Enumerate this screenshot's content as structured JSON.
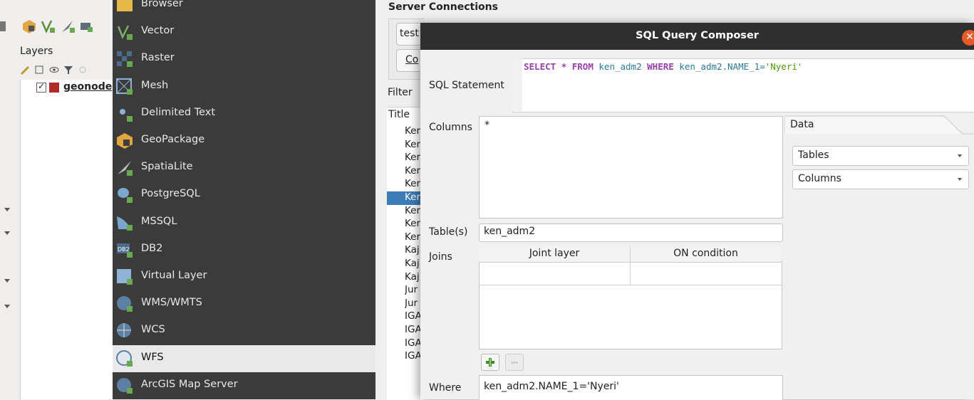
{
  "main_window": {
    "layers_panel": {
      "title": "Layers",
      "layer_item": {
        "label": "geonode",
        "checked": true,
        "color": "#b22b2b"
      }
    }
  },
  "data_source_manager": {
    "items": [
      {
        "label": "Browser",
        "icon": "folder-icon"
      },
      {
        "label": "Vector",
        "icon": "vector-icon"
      },
      {
        "label": "Raster",
        "icon": "raster-icon"
      },
      {
        "label": "Mesh",
        "icon": "mesh-icon"
      },
      {
        "label": "Delimited Text",
        "icon": "delimited-text-icon"
      },
      {
        "label": "GeoPackage",
        "icon": "geopackage-icon"
      },
      {
        "label": "SpatiaLite",
        "icon": "spatialite-icon"
      },
      {
        "label": "PostgreSQL",
        "icon": "postgresql-icon"
      },
      {
        "label": "MSSQL",
        "icon": "mssql-icon"
      },
      {
        "label": "DB2",
        "icon": "db2-icon"
      },
      {
        "label": "Virtual Layer",
        "icon": "virtual-layer-icon"
      },
      {
        "label": "WMS/WMTS",
        "icon": "wms-icon"
      },
      {
        "label": "WCS",
        "icon": "wcs-icon"
      },
      {
        "label": "WFS",
        "icon": "wfs-icon",
        "selected": true
      },
      {
        "label": "ArcGIS Map Server",
        "icon": "arcgis-icon"
      }
    ]
  },
  "wfs_panel": {
    "server_connections_title": "Server Connections",
    "connection_value": "test",
    "connect_button": "Co",
    "filter_label": "Filter",
    "title_header": "Title",
    "title_rows": [
      "Ker",
      "Ker",
      "Ker",
      "Ker",
      "Ker",
      "Ker",
      "Ker",
      "Ker",
      "Ker",
      "Kaj",
      "Kaj",
      "Kaj",
      "Jur",
      "Jur",
      "IGA",
      "IGA",
      "IGA",
      "IGA"
    ],
    "selected_row_index": 5
  },
  "sql_composer": {
    "title": "SQL Query Composer",
    "sql_statement_label": "SQL Statement",
    "sql": {
      "select": "SELECT",
      "star": "*",
      "from": "FROM",
      "table": "ken_adm2",
      "where": "WHERE",
      "field": "ken_adm2.NAME_1=",
      "value": "'Nyeri'"
    },
    "columns_label": "Columns",
    "columns_value": "*",
    "tables_label": "Table(s)",
    "tables_value": "ken_adm2",
    "joins_label": "Joins",
    "joins_headers": [
      "Joint layer",
      "ON condition"
    ],
    "where_label": "Where",
    "where_value": "ken_adm2.NAME_1='Nyeri'",
    "data_tab": "Data",
    "tables_combo": "Tables",
    "columns_combo": "Columns"
  }
}
